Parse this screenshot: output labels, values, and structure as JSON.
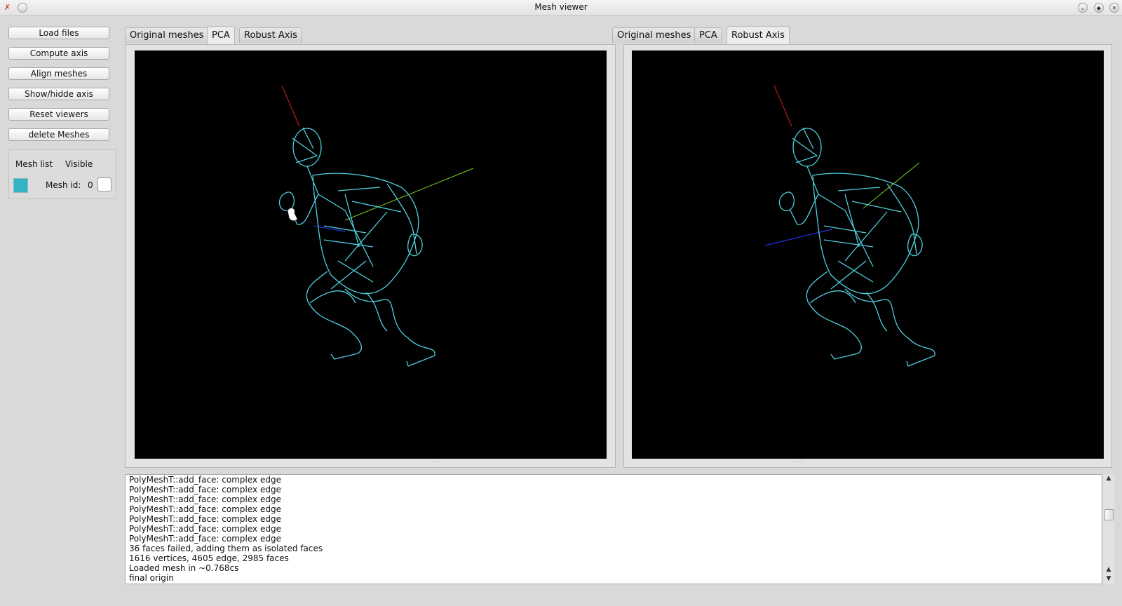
{
  "window": {
    "title": "Mesh viewer",
    "icons": {
      "app": "x-app-icon",
      "menu": "circle-menu-icon",
      "minimize": "chevron-down-icon",
      "maximize": "diamond-icon",
      "close": "close-icon"
    },
    "glyphs": {
      "app": "✗",
      "minimize": "⌄",
      "maximize": "◆",
      "close": "✕"
    }
  },
  "sidebar": {
    "buttons": [
      "Load files",
      "Compute axis",
      "Align meshes",
      "Show/hidde axis",
      "Reset viewers",
      "delete Meshes"
    ],
    "mesh_list": {
      "header_list": "Mesh list",
      "header_visible": "Visible",
      "label": "Mesh id:",
      "id_value": "0",
      "swatch_color": "#34b4c2"
    }
  },
  "left_view": {
    "tabs": [
      "Original meshes",
      "PCA",
      "Robust Axis"
    ],
    "active_tab": "PCA"
  },
  "right_view": {
    "tabs": [
      "Original meshes",
      "PCA",
      "Robust Axis"
    ],
    "active_tab": "Robust Axis"
  },
  "colors": {
    "mesh": "#4fd0df",
    "axis_x": "#e02020",
    "axis_y": "#7ed321",
    "axis_z": "#2233dd"
  },
  "console": {
    "lines": [
      "PolyMeshT::add_face: complex edge",
      "PolyMeshT::add_face: complex edge",
      "PolyMeshT::add_face: complex edge",
      "PolyMeshT::add_face: complex edge",
      "PolyMeshT::add_face: complex edge",
      "PolyMeshT::add_face: complex edge",
      "PolyMeshT::add_face: complex edge",
      "36 faces failed, adding them as isolated faces",
      "1616 vertices, 4605 edge, 2985 faces",
      "Loaded mesh in ~0.768cs",
      "final origin"
    ]
  }
}
